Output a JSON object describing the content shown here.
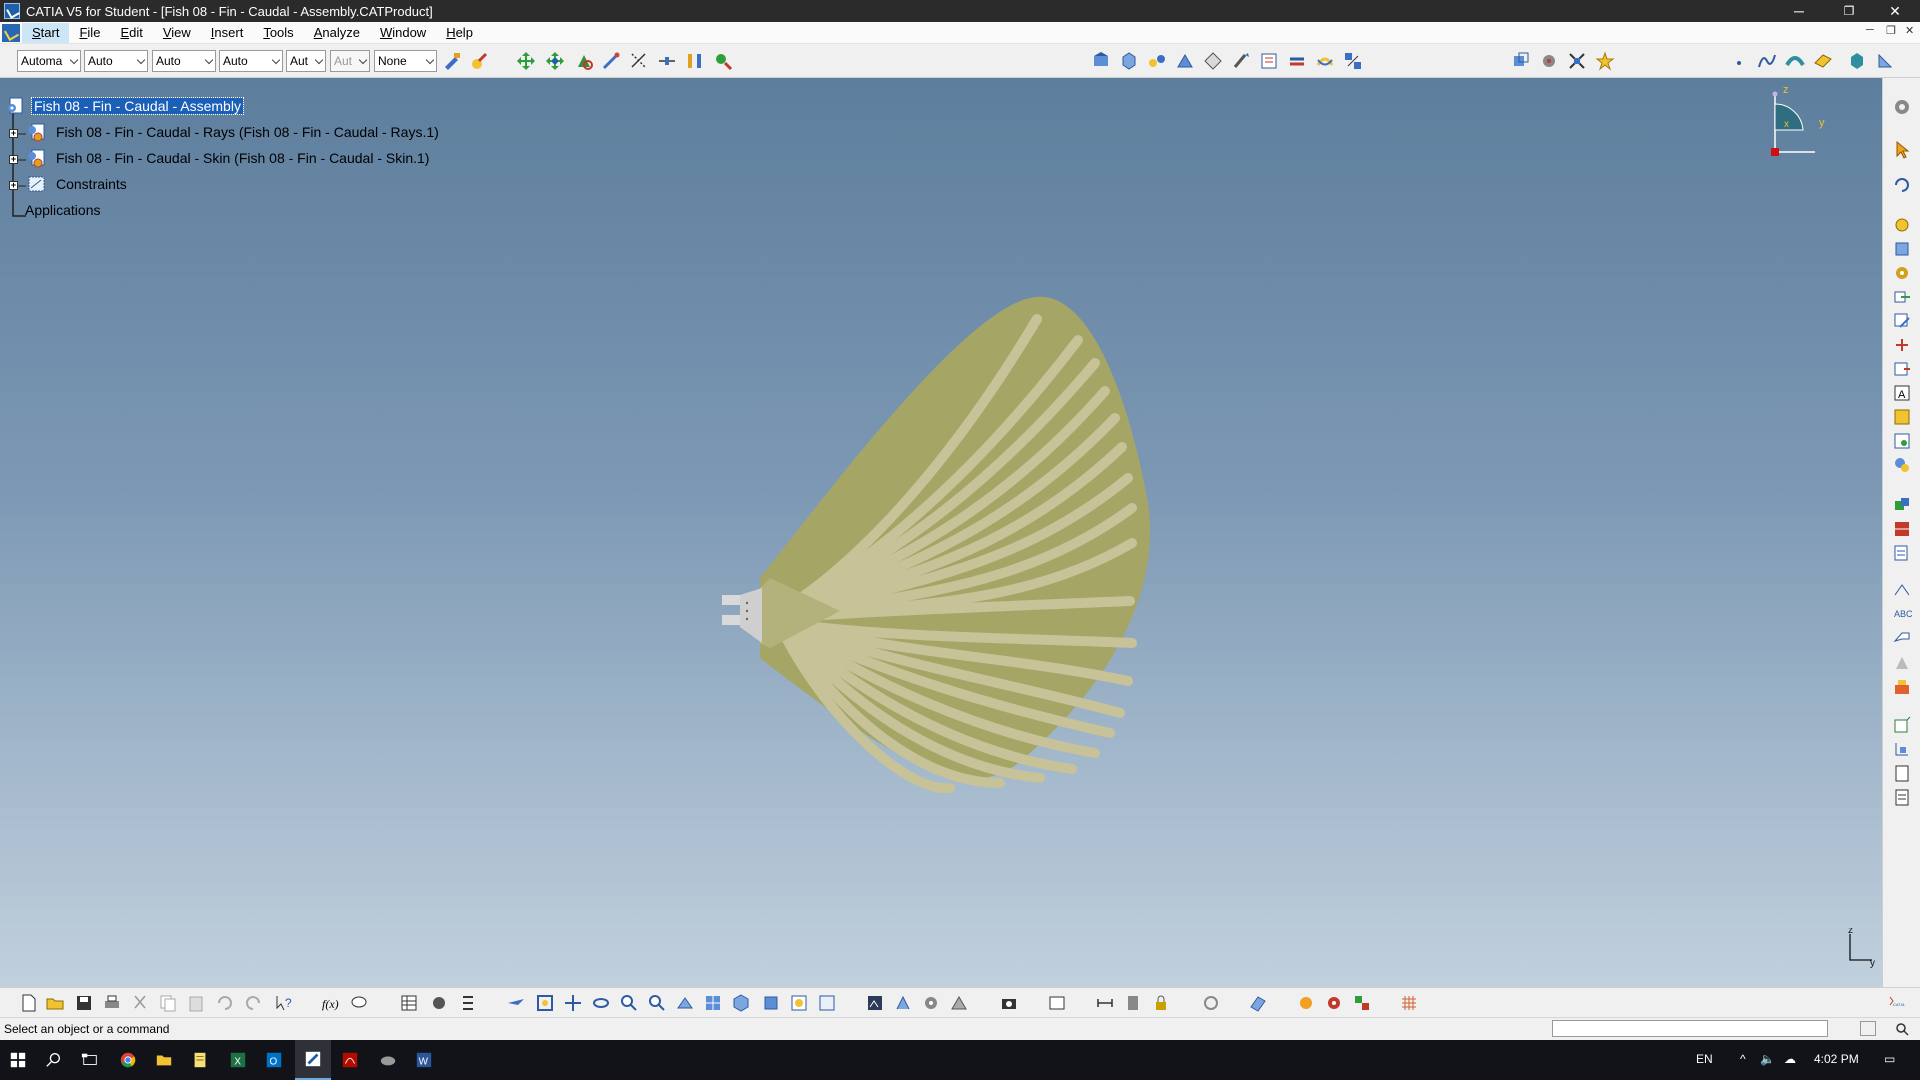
{
  "window": {
    "title": "CATIA V5 for Student - [Fish 08 - Fin - Caudal - Assembly.CATProduct]",
    "minimize": "─",
    "restore": "❐",
    "close": "✕"
  },
  "menu": {
    "items": [
      "Start",
      "File",
      "Edit",
      "View",
      "Insert",
      "Tools",
      "Analyze",
      "Window",
      "Help"
    ]
  },
  "toolbar": {
    "combos": [
      {
        "value": "Automa",
        "disabled": false
      },
      {
        "value": "Auto",
        "disabled": false
      },
      {
        "value": "Auto",
        "disabled": false
      },
      {
        "value": "Auto",
        "disabled": false
      },
      {
        "value": "Aut",
        "disabled": false
      },
      {
        "value": "Aut",
        "disabled": true
      },
      {
        "value": "None",
        "disabled": false
      }
    ]
  },
  "tree": {
    "root": "Fish 08 - Fin - Caudal - Assembly",
    "children": [
      "Fish 08 - Fin - Caudal - Rays (Fish 08 - Fin - Caudal - Rays.1)",
      "Fish 08 - Fin - Caudal - Skin (Fish 08 - Fin - Caudal - Skin.1)",
      "Constraints"
    ],
    "applications": "Applications"
  },
  "compass": {
    "z": "z",
    "y": "y",
    "x": "x"
  },
  "axis_triad": {
    "z": "z",
    "y": "y"
  },
  "model": {
    "fin_color": "#a5a566",
    "ray_color": "#c7c298",
    "background_top": "#5d7e9d",
    "background_bottom": "#c1d0dd"
  },
  "status": {
    "text": "Select an object or a command"
  },
  "taskbar": {
    "apps": [
      "start-icon",
      "search-icon",
      "task-view-icon",
      "chrome-icon",
      "file-explorer-icon",
      "notes-icon",
      "excel-icon",
      "outlook-icon",
      "catia-icon",
      "acrobat-icon",
      "game-icon",
      "word-icon"
    ],
    "lang": "EN",
    "time": "4:02 PM"
  }
}
